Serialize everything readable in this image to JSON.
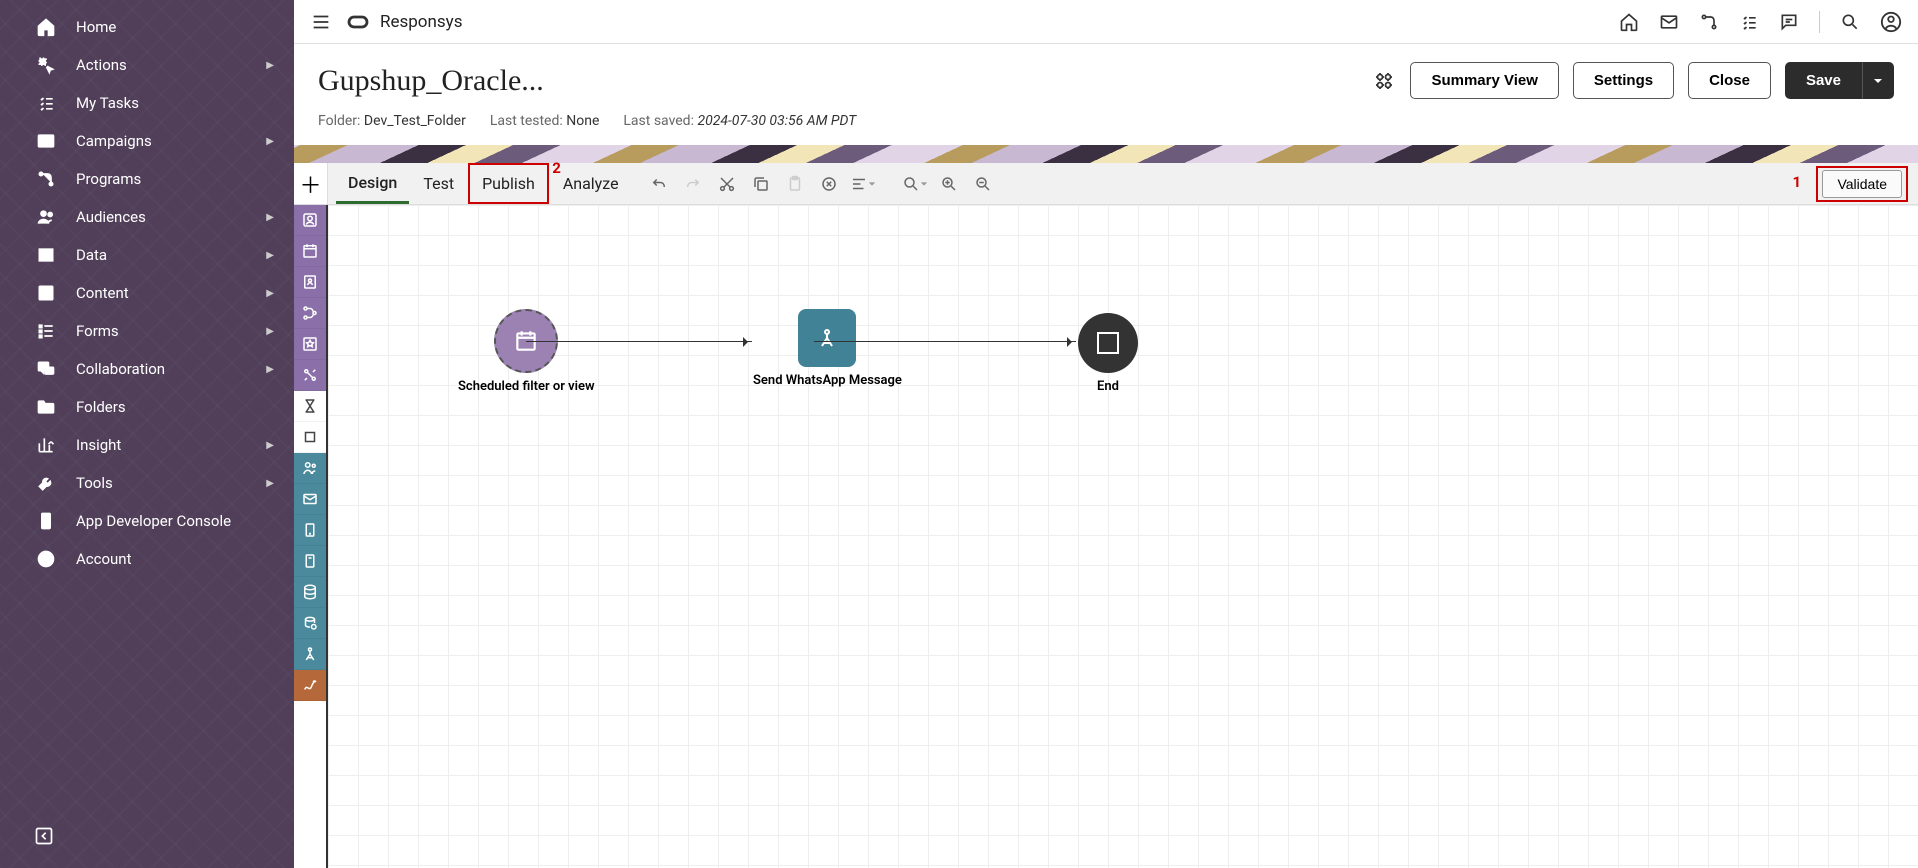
{
  "brand": "Responsys",
  "sidebar": {
    "items": [
      {
        "label": "Home",
        "icon": "home",
        "hasSub": false
      },
      {
        "label": "Actions",
        "icon": "actions",
        "hasSub": true
      },
      {
        "label": "My Tasks",
        "icon": "tasks",
        "hasSub": false
      },
      {
        "label": "Campaigns",
        "icon": "campaigns",
        "hasSub": true
      },
      {
        "label": "Programs",
        "icon": "programs",
        "hasSub": false
      },
      {
        "label": "Audiences",
        "icon": "audiences",
        "hasSub": true
      },
      {
        "label": "Data",
        "icon": "data",
        "hasSub": true
      },
      {
        "label": "Content",
        "icon": "content",
        "hasSub": true
      },
      {
        "label": "Forms",
        "icon": "forms",
        "hasSub": true
      },
      {
        "label": "Collaboration",
        "icon": "collab",
        "hasSub": true
      },
      {
        "label": "Folders",
        "icon": "folders",
        "hasSub": false
      },
      {
        "label": "Insight",
        "icon": "insight",
        "hasSub": true
      },
      {
        "label": "Tools",
        "icon": "tools",
        "hasSub": true
      },
      {
        "label": "App Developer Console",
        "icon": "console",
        "hasSub": false
      },
      {
        "label": "Account",
        "icon": "account",
        "hasSub": false
      }
    ]
  },
  "page": {
    "title": "Gupshup_Oracle...",
    "folder_label": "Folder:",
    "folder_value": "Dev_Test_Folder",
    "last_tested_label": "Last tested:",
    "last_tested_value": "None",
    "last_saved_label": "Last saved:",
    "last_saved_value": "2024-07-30 03:56 AM PDT",
    "buttons": {
      "summary": "Summary View",
      "settings": "Settings",
      "close": "Close",
      "save": "Save"
    }
  },
  "toolbar": {
    "tabs": [
      "Design",
      "Test",
      "Publish",
      "Analyze"
    ],
    "active_tab": "Design",
    "highlighted_tab": "Publish",
    "validate": "Validate",
    "callouts": {
      "validate": "1",
      "publish": "2"
    }
  },
  "nodes": {
    "start": "Scheduled filter or view",
    "mid": "Send WhatsApp Message",
    "end": "End"
  }
}
